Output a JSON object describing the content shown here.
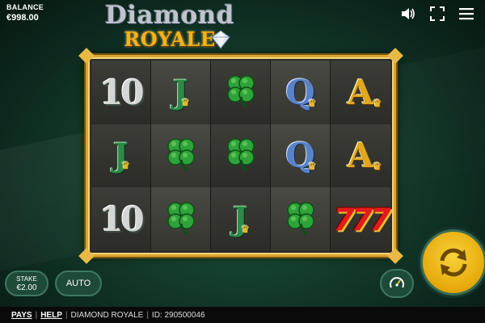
{
  "balance": {
    "label": "BALANCE",
    "value": "€998.00"
  },
  "logo": {
    "line1": "Diamond",
    "line2": "ROYALE"
  },
  "top_icons": {
    "sound": "speaker-icon",
    "fullscreen": "fullscreen-icon",
    "menu": "hamburger-menu-icon"
  },
  "reels": {
    "rows": [
      [
        "10",
        "J",
        "clover",
        "Q",
        "A"
      ],
      [
        "J",
        "clover",
        "clover",
        "Q",
        "A"
      ],
      [
        "10",
        "clover",
        "J",
        "clover",
        "777"
      ]
    ]
  },
  "controls": {
    "stake_label": "STAKE",
    "stake_value": "€2.00",
    "auto_label": "AUTO",
    "turbo_icon": "speedometer-icon",
    "spin_icon": "spin-arrows-icon"
  },
  "footer": {
    "pays": "PAYS",
    "help": "HELP",
    "game_name": "DIAMOND ROYALE",
    "id_text": "ID: 290500046"
  },
  "colors": {
    "accent_gold": "#e6a90b",
    "felt_green": "#1f5a42",
    "frame_gold": "#d9a530"
  }
}
